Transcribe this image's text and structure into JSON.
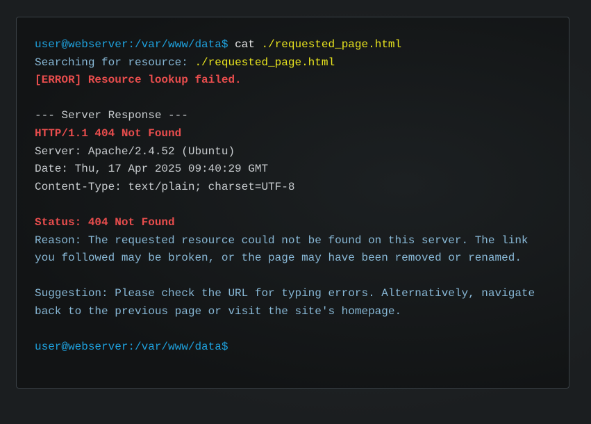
{
  "terminal": {
    "prompt": "user@webserver:/var/www/data$",
    "command": "cat",
    "command_arg": "./requested_page.html",
    "searching_label": "Searching for resource:",
    "searching_path": "./requested_page.html",
    "error_line": "[ERROR] Resource lookup failed.",
    "section_header": "--- Server Response ---",
    "http_status": "HTTP/1.1 404 Not Found",
    "server": "Server: Apache/2.4.52 (Ubuntu)",
    "date": "Date: Thu, 17 Apr 2025 09:40:29 GMT",
    "content_type": "Content-Type: text/plain; charset=UTF-8",
    "status": "Status: 404 Not Found",
    "reason_1": "Reason: The requested resource could not be found on this server. The link",
    "reason_2": "you followed may be broken, or the page may have been removed or renamed.",
    "suggestion_1": "Suggestion: Please check the URL for typing errors. Alternatively, navigate",
    "suggestion_2": "back to the previous page or visit the site's homepage.",
    "final_prompt": "user@webserver:/var/www/data$"
  }
}
